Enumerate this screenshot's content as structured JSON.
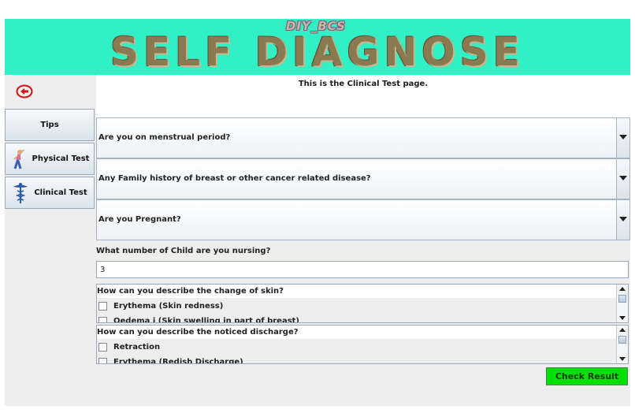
{
  "header": {
    "brand_small": "DIY_BCS",
    "brand_big": "SELF DIAGNOSE",
    "background": "#32f0c5"
  },
  "sidebar": {
    "back_icon": "back-arrow-icon",
    "items": [
      {
        "label": "Tips"
      },
      {
        "label": "Physical Test",
        "icon": "exercise-figure-icon"
      },
      {
        "label": "Clinical Test",
        "icon": "caduceus-icon"
      }
    ]
  },
  "main": {
    "page_title": "This is the Clinical Test page.",
    "questions": [
      {
        "label": "Are you on menstrual period?"
      },
      {
        "label": "Any Family history of breast or other cancer related disease?"
      },
      {
        "label": "Are you Pregnant?"
      }
    ],
    "nursing": {
      "label": "What number of Child are you nursing?",
      "value": "3"
    },
    "skin": {
      "question": "How can you describe the change of skin?",
      "options": [
        "Erythema (Skin redness)",
        "Oedema i (Skin swelling in part of breast)"
      ]
    },
    "discharge": {
      "question": "How can you describe the noticed discharge?",
      "options": [
        "Retraction",
        "Erythema (Redish Discharge)"
      ]
    },
    "check_result_label": "Check Result",
    "check_result_color": "#00e000"
  }
}
